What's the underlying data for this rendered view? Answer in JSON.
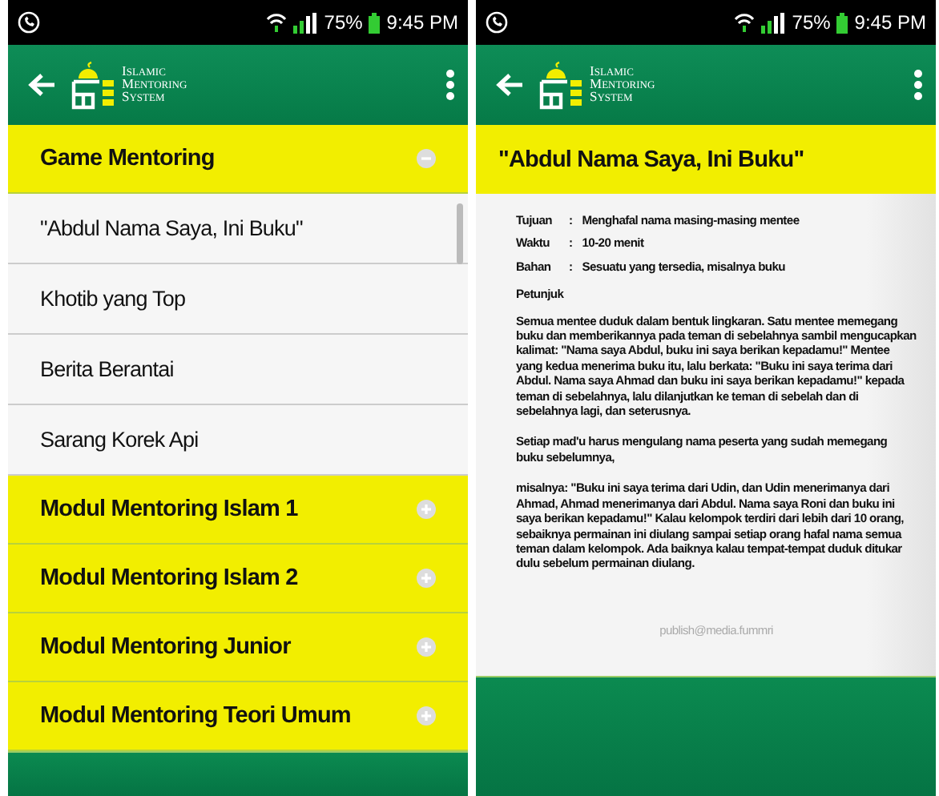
{
  "screens": [
    {
      "kind": "list",
      "status_bar": {
        "battery": "75%",
        "time": "9:45 PM"
      },
      "logo_text": [
        "ISLAMIC",
        "MENTORING",
        "SYSTEM"
      ],
      "groups": [
        {
          "title": "Game Mentoring",
          "expanded": true,
          "items": [
            "\"Abdul Nama Saya, Ini Buku\"",
            "Khotib yang Top",
            "Berita Berantai",
            "Sarang Korek Api"
          ]
        },
        {
          "title": "Modul Mentoring Islam 1",
          "expanded": false
        },
        {
          "title": "Modul Mentoring Islam 2",
          "expanded": false
        },
        {
          "title": "Modul Mentoring Junior",
          "expanded": false
        },
        {
          "title": "Modul Mentoring Teori Umum",
          "expanded": false
        }
      ]
    },
    {
      "kind": "detail",
      "status_bar": {
        "battery": "75%",
        "time": "9:45 PM"
      },
      "logo_text": [
        "ISLAMIC",
        "MENTORING",
        "SYSTEM"
      ],
      "title": "\"Abdul Nama Saya, Ini Buku\"",
      "fields": [
        {
          "label": "Tujuan",
          "separator": ":",
          "value": "Menghafal nama masing-masing mentee"
        },
        {
          "label": "Waktu",
          "separator": ":",
          "value": "10-20 menit"
        },
        {
          "label": "Bahan",
          "separator": ":",
          "value": "Sesuatu yang tersedia, misalnya buku"
        }
      ],
      "section_heading": "Petunjuk",
      "paragraphs": [
        "Semua mentee duduk dalam bentuk lingkaran. Satu mentee memegang buku dan memberikannya pada teman di sebelahnya sambil mengucapkan kalimat: \"Nama saya Abdul, buku ini saya berikan kepadamu!\" Mentee yang kedua menerima buku itu, lalu berkata: \"Buku ini saya terima dari Abdul. Nama saya Ahmad dan buku ini saya berikan kepadamu!\" kepada teman di sebelahnya, lalu dilanjutkan ke teman di sebelah dan di sebelahnya lagi, dan seterusnya.",
        "Setiap mad'u harus mengulang nama peserta yang sudah memegang buku sebelumnya,",
        "misalnya: \"Buku ini saya terima dari Udin, dan Udin menerimanya dari Ahmad, Ahmad menerimanya dari Abdul. Nama saya Roni dan buku ini saya berikan kepadamu!\" Kalau kelompok terdiri dari lebih dari 10 orang, sebaiknya permainan ini diulang sampai setiap orang hafal nama semua teman dalam kelompok. Ada baiknya kalau tempat-tempat duduk ditukar dulu sebelum permainan diulang."
      ],
      "footer_text": "publish@media.fummri"
    }
  ]
}
